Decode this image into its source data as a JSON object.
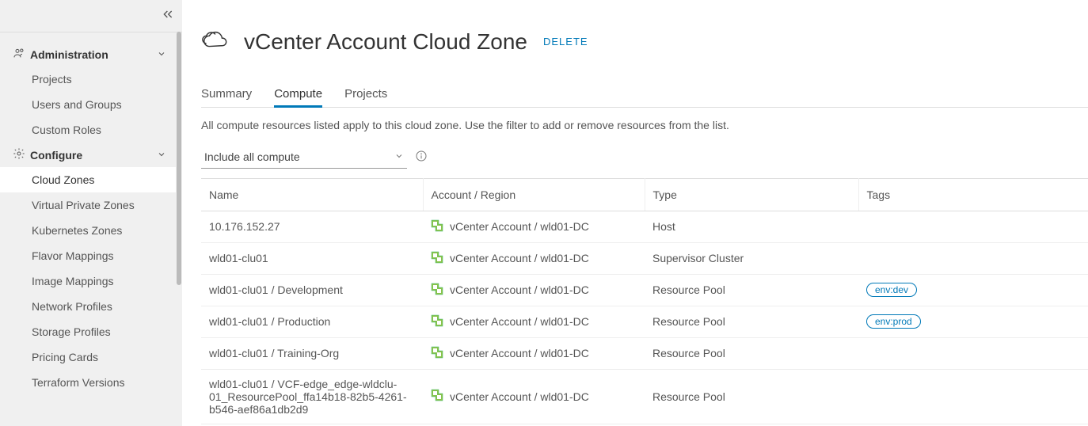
{
  "sidebar": {
    "sections": [
      {
        "key": "admin",
        "label": "Administration",
        "expanded": true,
        "items": [
          {
            "key": "projects",
            "label": "Projects",
            "active": false
          },
          {
            "key": "users-groups",
            "label": "Users and Groups",
            "active": false
          },
          {
            "key": "custom-roles",
            "label": "Custom Roles",
            "active": false
          }
        ]
      },
      {
        "key": "configure",
        "label": "Configure",
        "expanded": true,
        "items": [
          {
            "key": "cloud-zones",
            "label": "Cloud Zones",
            "active": true
          },
          {
            "key": "vpz",
            "label": "Virtual Private Zones",
            "active": false
          },
          {
            "key": "k8s-zones",
            "label": "Kubernetes Zones",
            "active": false
          },
          {
            "key": "flavor-mappings",
            "label": "Flavor Mappings",
            "active": false
          },
          {
            "key": "image-mappings",
            "label": "Image Mappings",
            "active": false
          },
          {
            "key": "network-profiles",
            "label": "Network Profiles",
            "active": false
          },
          {
            "key": "storage-profiles",
            "label": "Storage Profiles",
            "active": false
          },
          {
            "key": "pricing-cards",
            "label": "Pricing Cards",
            "active": false
          },
          {
            "key": "terraform-versions",
            "label": "Terraform Versions",
            "active": false
          }
        ]
      }
    ]
  },
  "header": {
    "title": "vCenter Account Cloud Zone",
    "delete_label": "DELETE"
  },
  "tabs": {
    "summary": "Summary",
    "compute": "Compute",
    "projects": "Projects",
    "active": "compute"
  },
  "description": "All compute resources listed apply to this cloud zone. Use the filter to add or remove resources from the list.",
  "filter": {
    "selected": "Include all compute"
  },
  "table": {
    "columns": {
      "name": "Name",
      "account": "Account / Region",
      "type": "Type",
      "tags": "Tags"
    },
    "rows": [
      {
        "name": "10.176.152.27",
        "account": "vCenter Account / wld01-DC",
        "type": "Host",
        "tags": []
      },
      {
        "name": "wld01-clu01",
        "account": "vCenter Account / wld01-DC",
        "type": "Supervisor Cluster",
        "tags": []
      },
      {
        "name": "wld01-clu01 / Development",
        "account": "vCenter Account / wld01-DC",
        "type": "Resource Pool",
        "tags": [
          "env:dev"
        ]
      },
      {
        "name": "wld01-clu01 / Production",
        "account": "vCenter Account / wld01-DC",
        "type": "Resource Pool",
        "tags": [
          "env:prod"
        ]
      },
      {
        "name": "wld01-clu01 / Training-Org",
        "account": "vCenter Account / wld01-DC",
        "type": "Resource Pool",
        "tags": []
      },
      {
        "name": "wld01-clu01 / VCF-edge_edge-wldclu-01_ResourcePool_ffa14b18-82b5-4261-b546-aef86a1db2d9",
        "account": "vCenter Account / wld01-DC",
        "type": "Resource Pool",
        "tags": []
      }
    ]
  }
}
